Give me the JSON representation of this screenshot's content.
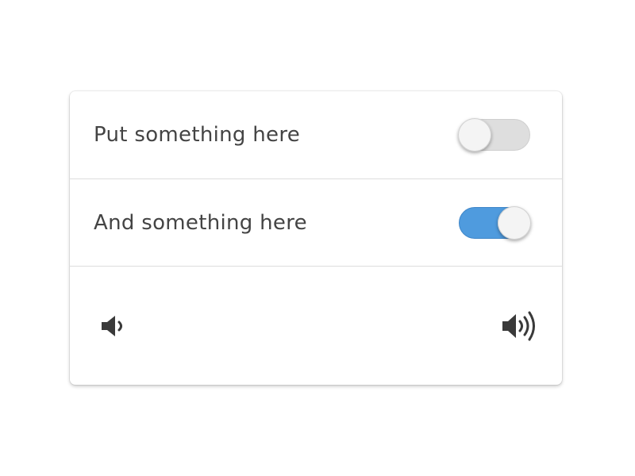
{
  "settings": {
    "rows": [
      {
        "label": "Put something here",
        "toggle_on": false
      },
      {
        "label": "And something here",
        "toggle_on": true
      }
    ],
    "volume": {
      "min_icon": "speaker-low-icon",
      "max_icon": "speaker-high-icon"
    }
  },
  "colors": {
    "toggle_on": "#4f9bde",
    "toggle_off": "#dedede",
    "text": "#444444",
    "divider": "#dddddd"
  }
}
